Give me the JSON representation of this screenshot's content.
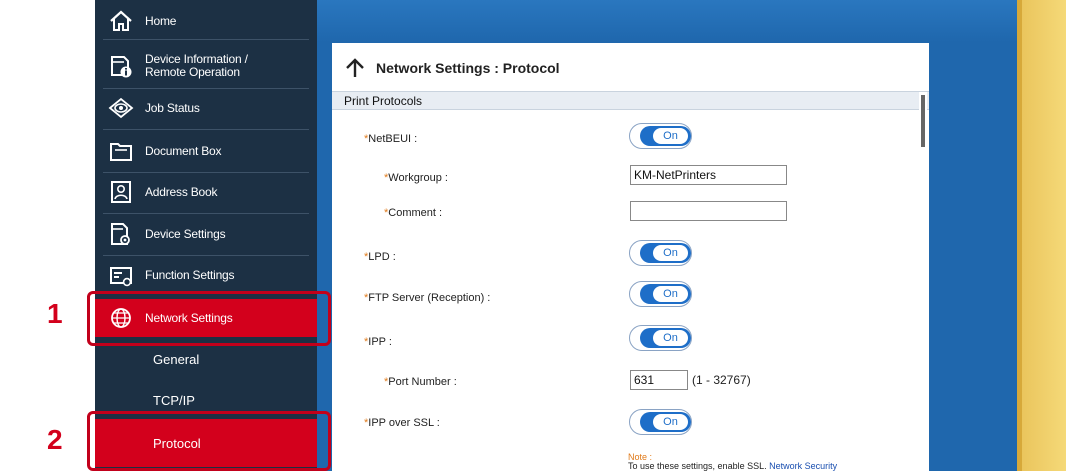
{
  "sidebar": {
    "items": [
      {
        "label_line1": "Home",
        "label_line2": "",
        "icon": "home-icon"
      },
      {
        "label_line1": "Device Information /",
        "label_line2": "Remote Operation",
        "icon": "device-information-icon"
      },
      {
        "label_line1": "Job Status",
        "label_line2": "",
        "icon": "eye-icon"
      },
      {
        "label_line1": "Document Box",
        "label_line2": "",
        "icon": "folder-icon"
      },
      {
        "label_line1": "Address Book",
        "label_line2": "",
        "icon": "contact-card-icon"
      },
      {
        "label_line1": "Device Settings",
        "label_line2": "",
        "icon": "device-settings-icon"
      },
      {
        "label_line1": "Function Settings",
        "label_line2": "",
        "icon": "function-settings-icon"
      },
      {
        "label_line1": "Network Settings",
        "label_line2": "",
        "icon": "globe-icon"
      }
    ],
    "subitems": [
      {
        "label": "General"
      },
      {
        "label": "TCP/IP"
      },
      {
        "label": "Protocol"
      }
    ]
  },
  "panel": {
    "title": "Network Settings : Protocol",
    "section": "Print Protocols",
    "rows": {
      "netbeui": {
        "label": "NetBEUI :",
        "toggle": "On"
      },
      "workgroup": {
        "label": "Workgroup :",
        "value": "KM-NetPrinters"
      },
      "comment": {
        "label": "Comment :",
        "value": ""
      },
      "lpd": {
        "label": "LPD :",
        "toggle": "On"
      },
      "ftp": {
        "label": "FTP Server (Reception) :",
        "toggle": "On"
      },
      "ipp": {
        "label": "IPP :",
        "toggle": "On"
      },
      "port": {
        "label": "Port Number :",
        "value": "631",
        "range": "(1 - 32767)"
      },
      "ipp_ssl": {
        "label": "IPP over SSL :",
        "toggle": "On"
      }
    },
    "note": {
      "title": "Note :",
      "text": "To use these settings, enable SSL.",
      "link": "Network Security"
    },
    "required_mark": "*"
  },
  "callouts": {
    "first": "1",
    "second": "2"
  },
  "colors": {
    "sidebar": "#1c3044",
    "active": "#d3001c",
    "content_bg": "#1f67ad",
    "toggle_on": "#1e6ec8",
    "callout": "#c2001b"
  }
}
